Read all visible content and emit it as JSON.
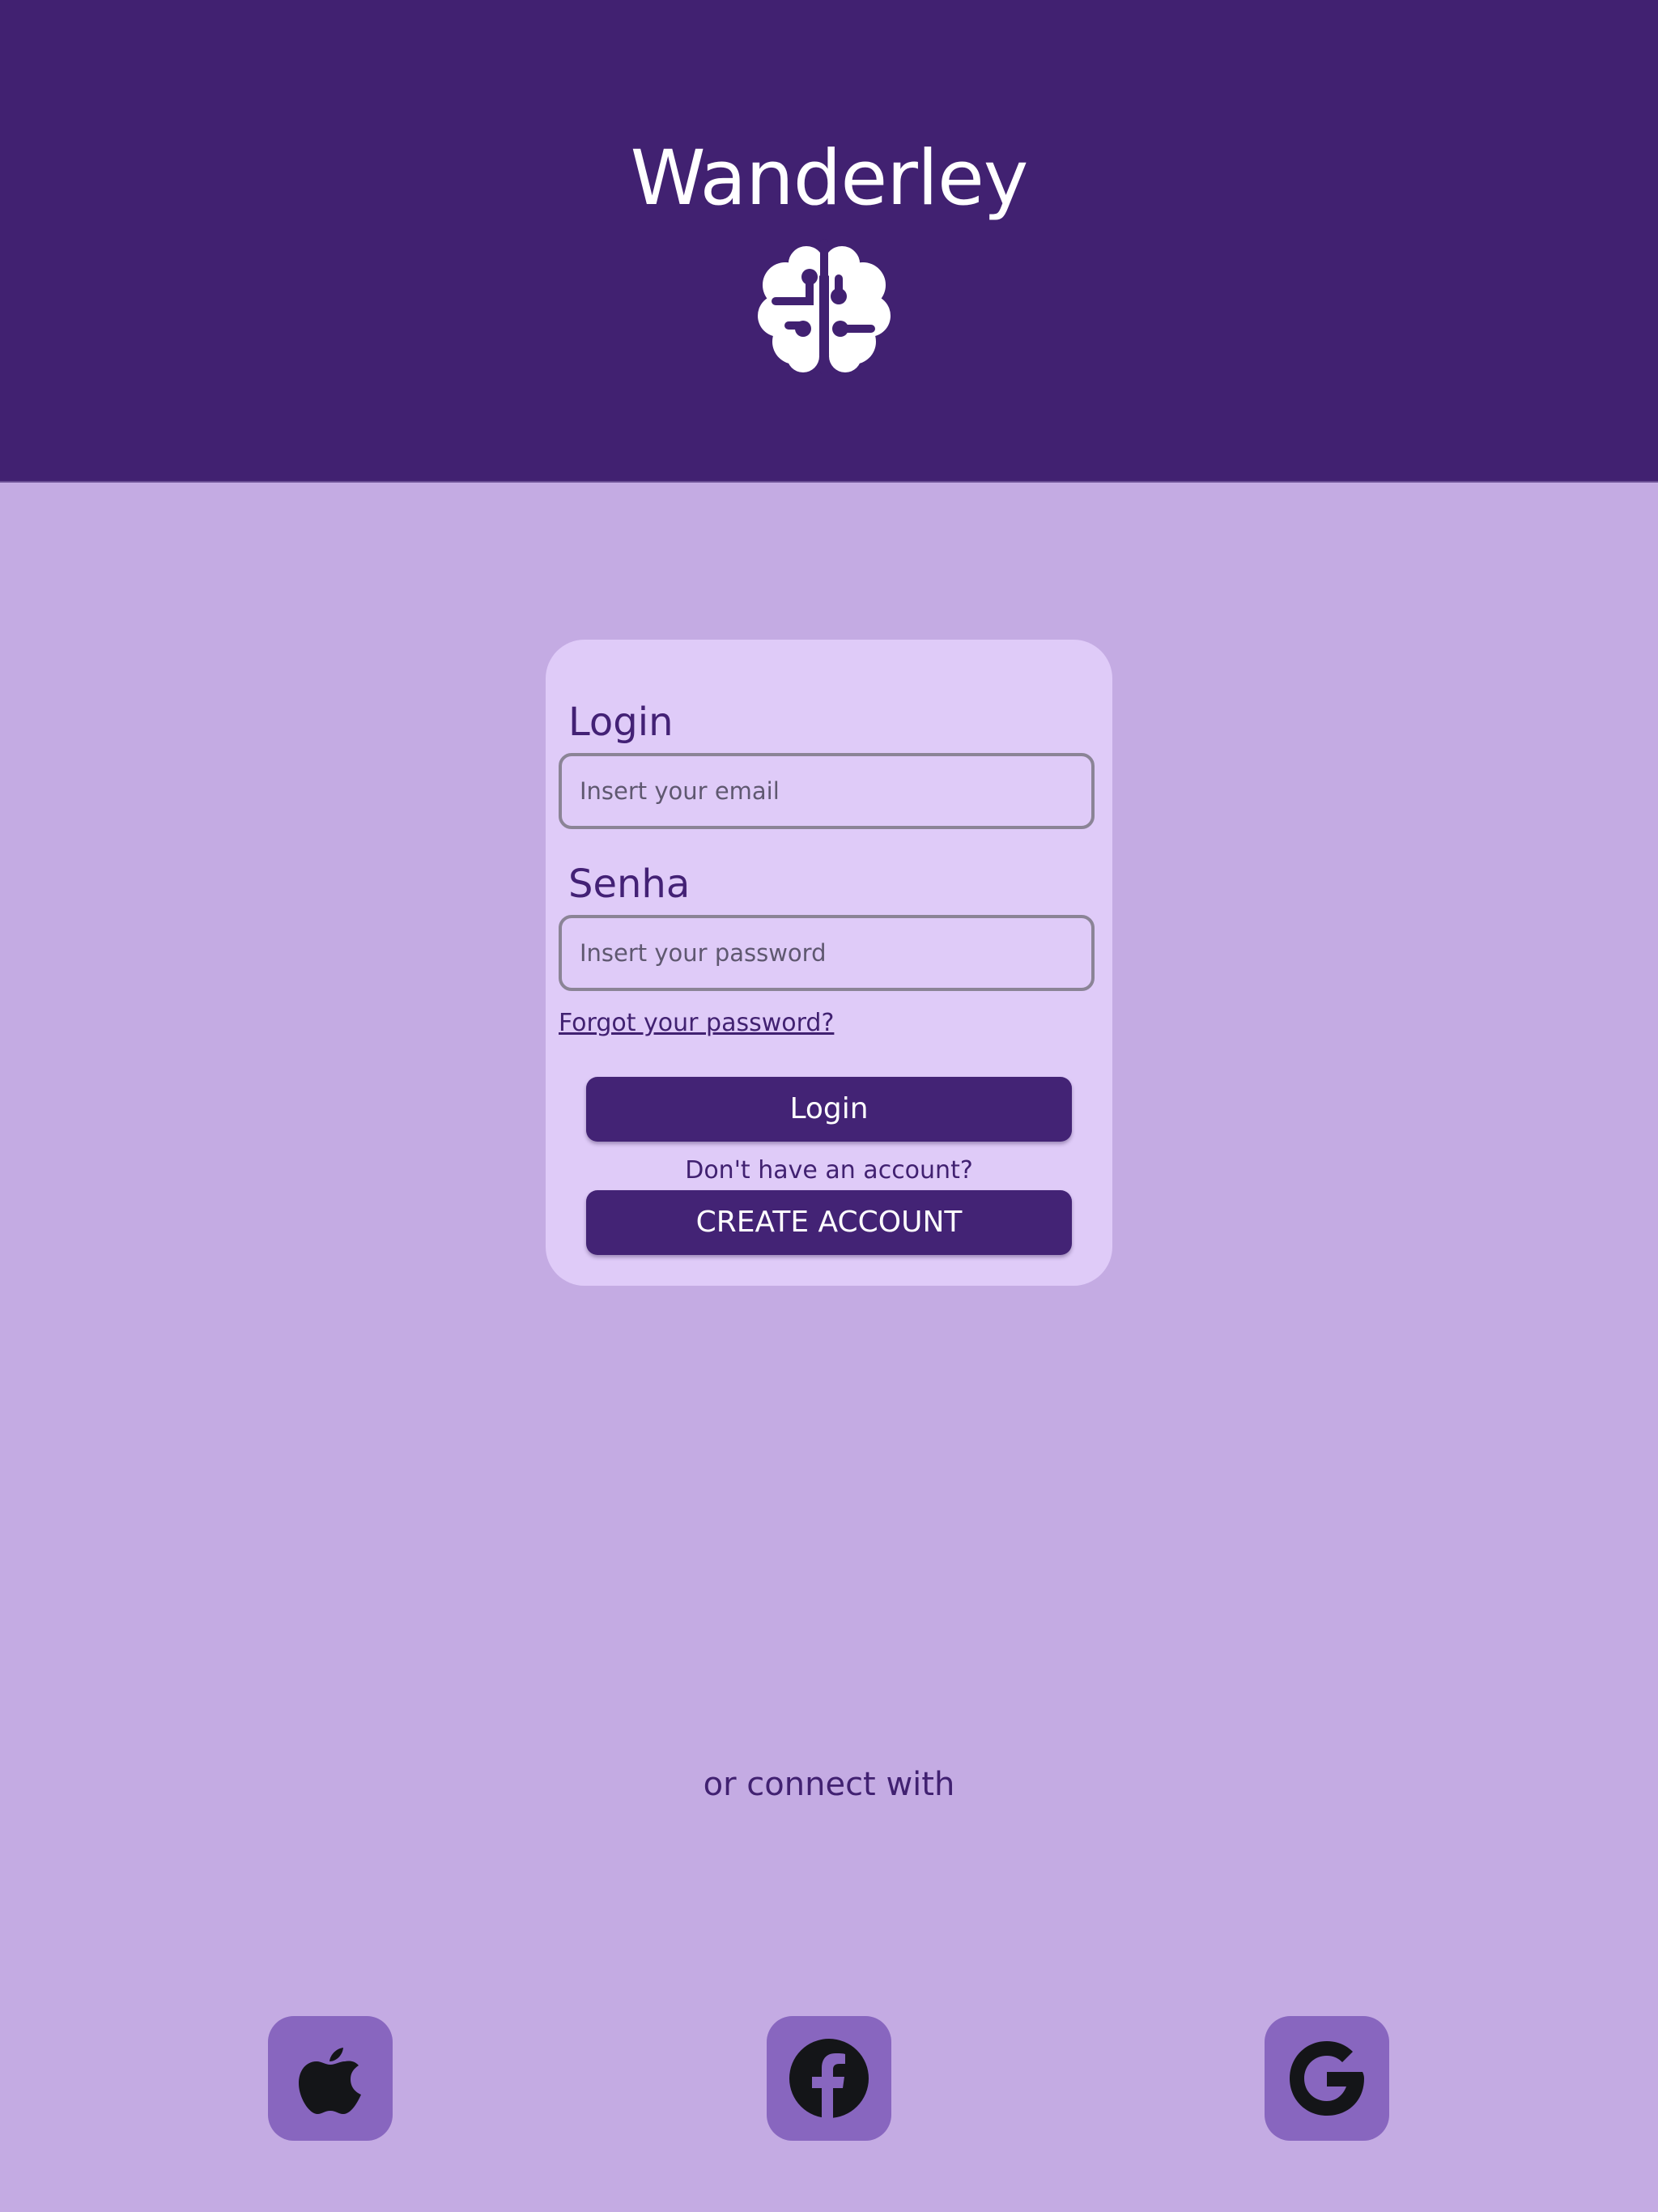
{
  "header": {
    "app_title": "Wanderley",
    "logo_icon": "brain-icon",
    "background_color": "#412171"
  },
  "login_card": {
    "email_label": "Login",
    "email_placeholder": "Insert your email",
    "email_value": "",
    "password_label": "Senha",
    "password_placeholder": "Insert your password",
    "password_value": "",
    "forgot_password_link": "Forgot your password?",
    "login_button_label": "Login",
    "no_account_text": "Don't have an account?",
    "create_account_button_label": "CREATE ACCOUNT"
  },
  "social": {
    "connect_text": "or connect with",
    "providers": [
      {
        "name": "Apple",
        "icon": "apple-icon"
      },
      {
        "name": "Facebook",
        "icon": "facebook-icon"
      },
      {
        "name": "Google",
        "icon": "google-icon"
      }
    ]
  },
  "colors": {
    "primary": "#412171",
    "page_background": "#c4abe3",
    "card_background": "#dfcbf8",
    "social_button": "#8866bf"
  }
}
